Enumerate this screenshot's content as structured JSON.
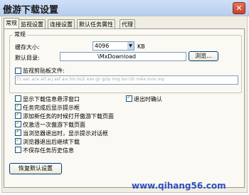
{
  "window": {
    "title": "傲游下载设置",
    "close_glyph": "✕"
  },
  "tabs": [
    "常规",
    "监视设置",
    "连接设置",
    "默认任务属性",
    "代理"
  ],
  "general_group": {
    "title": "常规",
    "cache_label": "缓存大小:",
    "cache_value": "4096",
    "cache_unit": "KB",
    "dir_label": "默认目录:",
    "dir_value": "\\MxDownload",
    "browse_label": "浏览...",
    "clipboard_label": "监视剪贴板文件:",
    "clipboard_exts": "7z aac ace aif arj asf avi bin bz2 exe gz gzip img iso lzh m4a mov mp"
  },
  "options": [
    {
      "label": "显示下载信息悬浮窗口",
      "checked": false
    },
    {
      "label": "任务完成后显示提示框",
      "checked": true
    },
    {
      "label": "添加新任务的时候打开傲游下载页面",
      "checked": true
    },
    {
      "label": "仅激活一次傲游下载页面",
      "checked": true
    },
    {
      "label": "当浏览器退出时，显示提示对话框",
      "checked": true
    },
    {
      "label": "浏览器退出后继续下载",
      "checked": true
    },
    {
      "label": "不保存任务历史信息",
      "checked": false
    }
  ],
  "exit_confirm": {
    "label": "退出时确认",
    "checked": true
  },
  "restore_label": "恢复默认设置",
  "watermark": "www.qihang56.com"
}
